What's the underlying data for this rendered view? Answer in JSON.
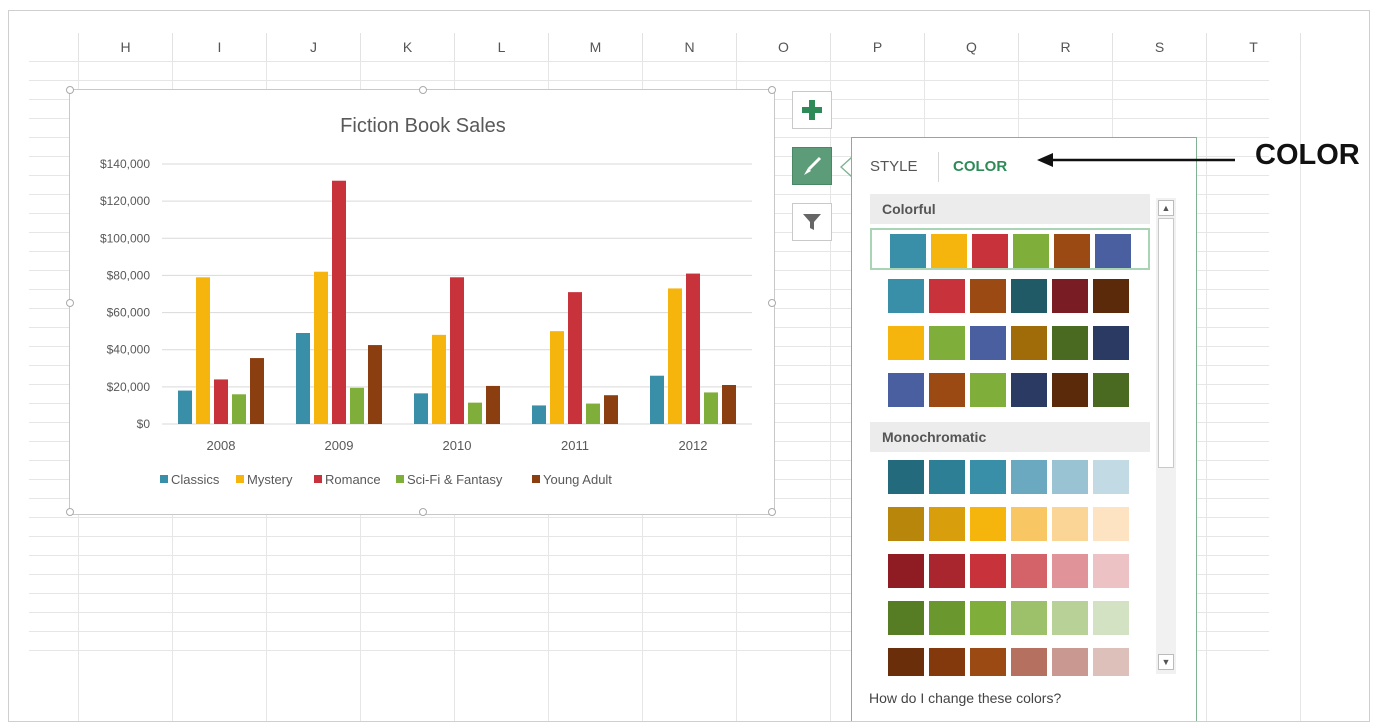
{
  "columns": [
    "H",
    "I",
    "J",
    "K",
    "L",
    "M",
    "N",
    "O",
    "P",
    "Q",
    "R",
    "S",
    "T"
  ],
  "chart_data": {
    "type": "bar",
    "title": "Fiction Book Sales",
    "categories": [
      "2008",
      "2009",
      "2010",
      "2011",
      "2012"
    ],
    "series": [
      {
        "name": "Classics",
        "color": "#3a8fa8",
        "values": [
          18000,
          49000,
          16500,
          10000,
          26000
        ]
      },
      {
        "name": "Mystery",
        "color": "#f5b50d",
        "values": [
          79000,
          82000,
          48000,
          50000,
          73000
        ]
      },
      {
        "name": "Romance",
        "color": "#c8323a",
        "values": [
          24000,
          131000,
          79000,
          71000,
          81000
        ]
      },
      {
        "name": "Sci-Fi & Fantasy",
        "color": "#7fae3a",
        "values": [
          16000,
          19500,
          11500,
          11000,
          17000
        ]
      },
      {
        "name": "Young Adult",
        "color": "#8b3e10",
        "values": [
          35500,
          42500,
          20500,
          15500,
          21000
        ]
      }
    ],
    "yticks": [
      "$0",
      "$20,000",
      "$40,000",
      "$60,000",
      "$80,000",
      "$100,000",
      "$120,000",
      "$140,000"
    ],
    "ylim": [
      0,
      140000
    ],
    "legend": "bottom",
    "grid": true
  },
  "side_buttons": {
    "add": "chart-elements",
    "style": "chart-styles",
    "filter": "chart-filters"
  },
  "panel": {
    "tabs": [
      "STYLE",
      "COLOR"
    ],
    "active_tab": "COLOR",
    "sections": [
      {
        "title": "Colorful",
        "rows": [
          [
            "#3a8fa8",
            "#f5b50d",
            "#c8323a",
            "#7fae3a",
            "#9a4a12",
            "#4a5fa0"
          ],
          [
            "#3a8fa8",
            "#c8323a",
            "#9a4a12",
            "#1f5a66",
            "#7a1c23",
            "#5a2a0a"
          ],
          [
            "#f5b50d",
            "#7fae3a",
            "#4a5fa0",
            "#a06c0a",
            "#4a6a22",
            "#2a3a62"
          ],
          [
            "#4a5fa0",
            "#9a4a12",
            "#7fae3a",
            "#2a3a62",
            "#5a2a0a",
            "#4a6a22"
          ]
        ]
      },
      {
        "title": "Monochromatic",
        "rows": [
          [
            "#236a7c",
            "#2d7f96",
            "#3a8fa8",
            "#6aa9bf",
            "#99c3d2",
            "#c2dae3"
          ],
          [
            "#b8860b",
            "#d99e0c",
            "#f5b50d",
            "#f8c662",
            "#fad596",
            "#fde3c2"
          ],
          [
            "#8e1c22",
            "#aa262e",
            "#c8323a",
            "#d46269",
            "#e09499",
            "#ecc2c4"
          ],
          [
            "#567c24",
            "#6a972e",
            "#7fae3a",
            "#9dc16b",
            "#b7d197",
            "#d2e2c2"
          ],
          [
            "#6b2e0a",
            "#84390d",
            "#9a4a12",
            "#b57060",
            "#c99890",
            "#dec0ba"
          ]
        ]
      }
    ],
    "help_text": "How do I change these colors?"
  },
  "annotation": {
    "label": "COLOR"
  }
}
